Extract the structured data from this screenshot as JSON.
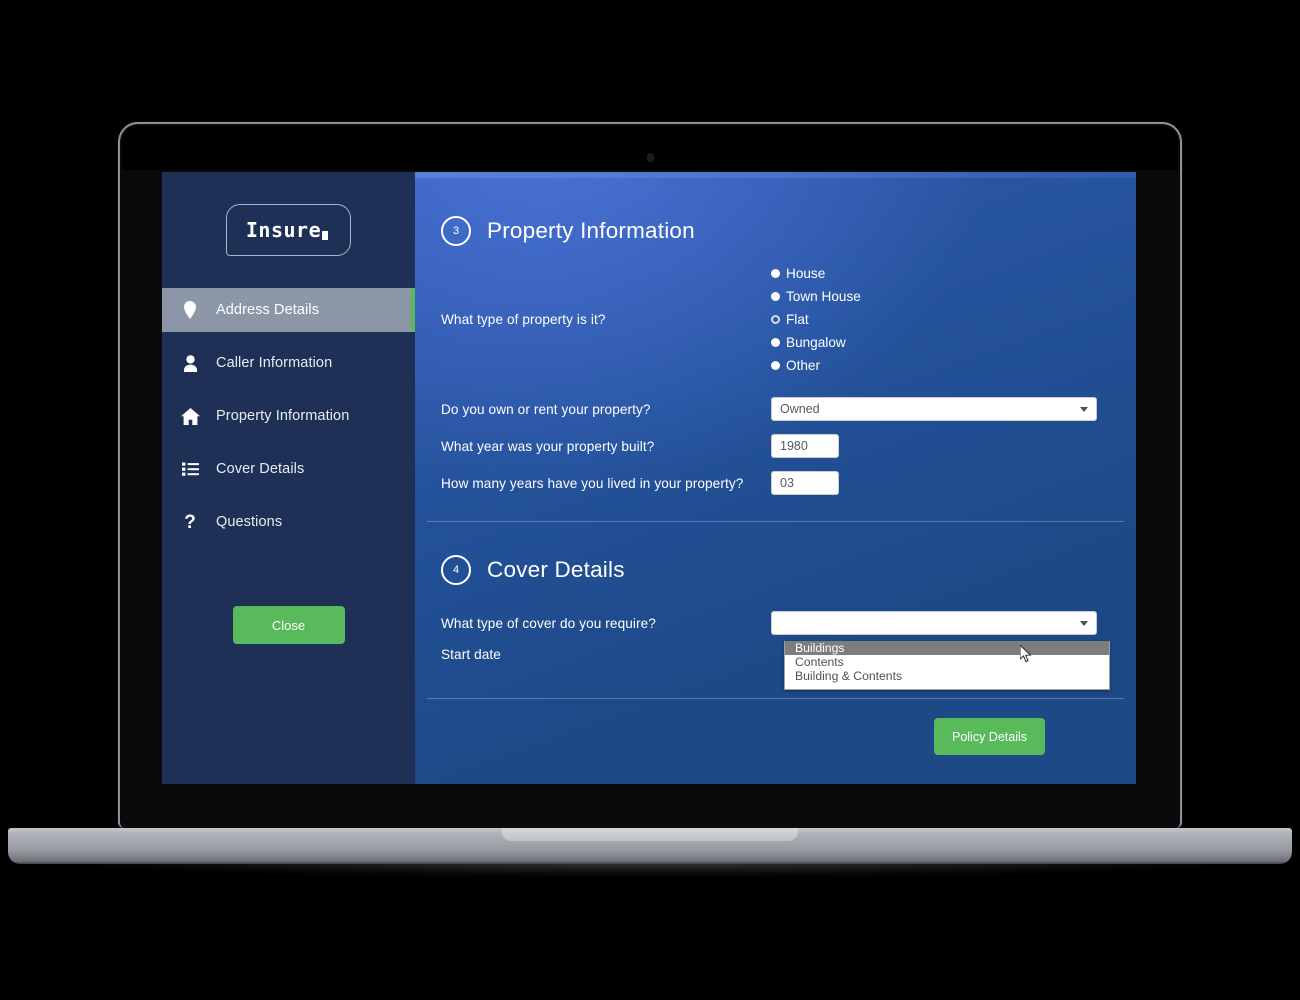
{
  "sidebar": {
    "logo": {
      "text": "Insure",
      "mark": "square-mark"
    },
    "items": [
      {
        "label": "Address Details",
        "icon": "map-pin-icon",
        "active": true
      },
      {
        "label": "Caller Information",
        "icon": "user-icon",
        "active": false
      },
      {
        "label": "Property Information",
        "icon": "home-icon",
        "active": false
      },
      {
        "label": "Cover Details",
        "icon": "list-icon",
        "active": false
      },
      {
        "label": "Questions",
        "icon": "question-mark-icon",
        "active": false
      }
    ],
    "close_label": "Close"
  },
  "property_section": {
    "number": "3",
    "title": "Property Information",
    "type_question": "What type of property is it?",
    "type_options": [
      {
        "label": "House",
        "selected": false
      },
      {
        "label": "Town House",
        "selected": false
      },
      {
        "label": "Flat",
        "selected": true
      },
      {
        "label": "Bungalow",
        "selected": false
      },
      {
        "label": "Other",
        "selected": false
      }
    ],
    "own_rent_question": "Do you own or rent your property?",
    "own_rent_value": "Owned",
    "year_built_question": "What year was your property built?",
    "year_built_value": "1980",
    "years_lived_question": "How many years have you lived in your property?",
    "years_lived_value": "03"
  },
  "cover_section": {
    "number": "4",
    "title": "Cover Details",
    "cover_question": "What type of cover do you require?",
    "cover_value": "",
    "start_date_label": "Start date",
    "cover_options": [
      {
        "label": "Buildings",
        "highlighted": true
      },
      {
        "label": "Contents",
        "highlighted": false
      },
      {
        "label": "Building & Contents",
        "highlighted": false
      }
    ]
  },
  "footer": {
    "policy_label": "Policy Details"
  },
  "colors": {
    "sidebar_bg": "#1e3055",
    "panel_blue": "#1d4987",
    "panel_blue_light": "#4a73d8",
    "accent_green": "#59ba5c",
    "active_nav": "#8b96a6",
    "dropdown_highlight": "#7d7d7d"
  }
}
